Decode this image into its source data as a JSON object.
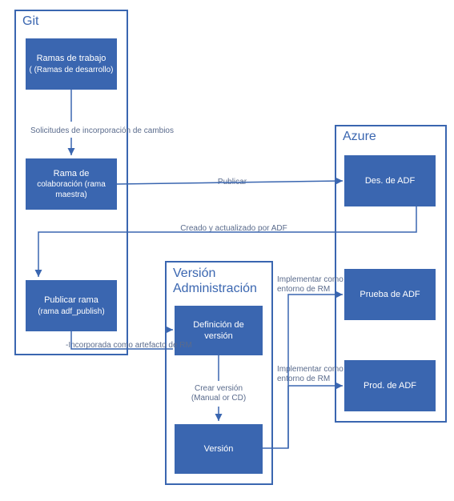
{
  "containers": {
    "git": {
      "title": "Git"
    },
    "release": {
      "title_line1": "Versión",
      "title_line2": "Administración"
    },
    "azure": {
      "title": "Azure"
    }
  },
  "boxes": {
    "working_branches": {
      "line1": "Ramas de trabajo",
      "line2": "( (Ramas de desarrollo)"
    },
    "collab_branch": {
      "line1": "Rama de",
      "line2": "colaboración (rama maestra)"
    },
    "publish_branch": {
      "line1": "Publicar rama",
      "line2": "(rama adf_publish)"
    },
    "release_def": {
      "line1": "Definición de versión",
      "line2": ""
    },
    "release": {
      "line1": "Versión",
      "line2": ""
    },
    "adf_dev": {
      "line1": "Des. de ADF",
      "line2": ""
    },
    "adf_test": {
      "line1": "Prueba de ADF",
      "line2": ""
    },
    "adf_prod": {
      "line1": "Prod. de ADF",
      "line2": ""
    }
  },
  "edges": {
    "pull_requests": "Solicitudes de incorporación de cambios",
    "publish": "Publicar",
    "created_updated": "Creado y actualizado por ADF",
    "pulled_artifact": "-Incorporada como artefacto de RM",
    "create_release_l1": "Crear versión",
    "create_release_l2": "(Manual or CD)",
    "deploy_env_l1": "Implementar como",
    "deploy_env_l2": "entorno de RM"
  }
}
